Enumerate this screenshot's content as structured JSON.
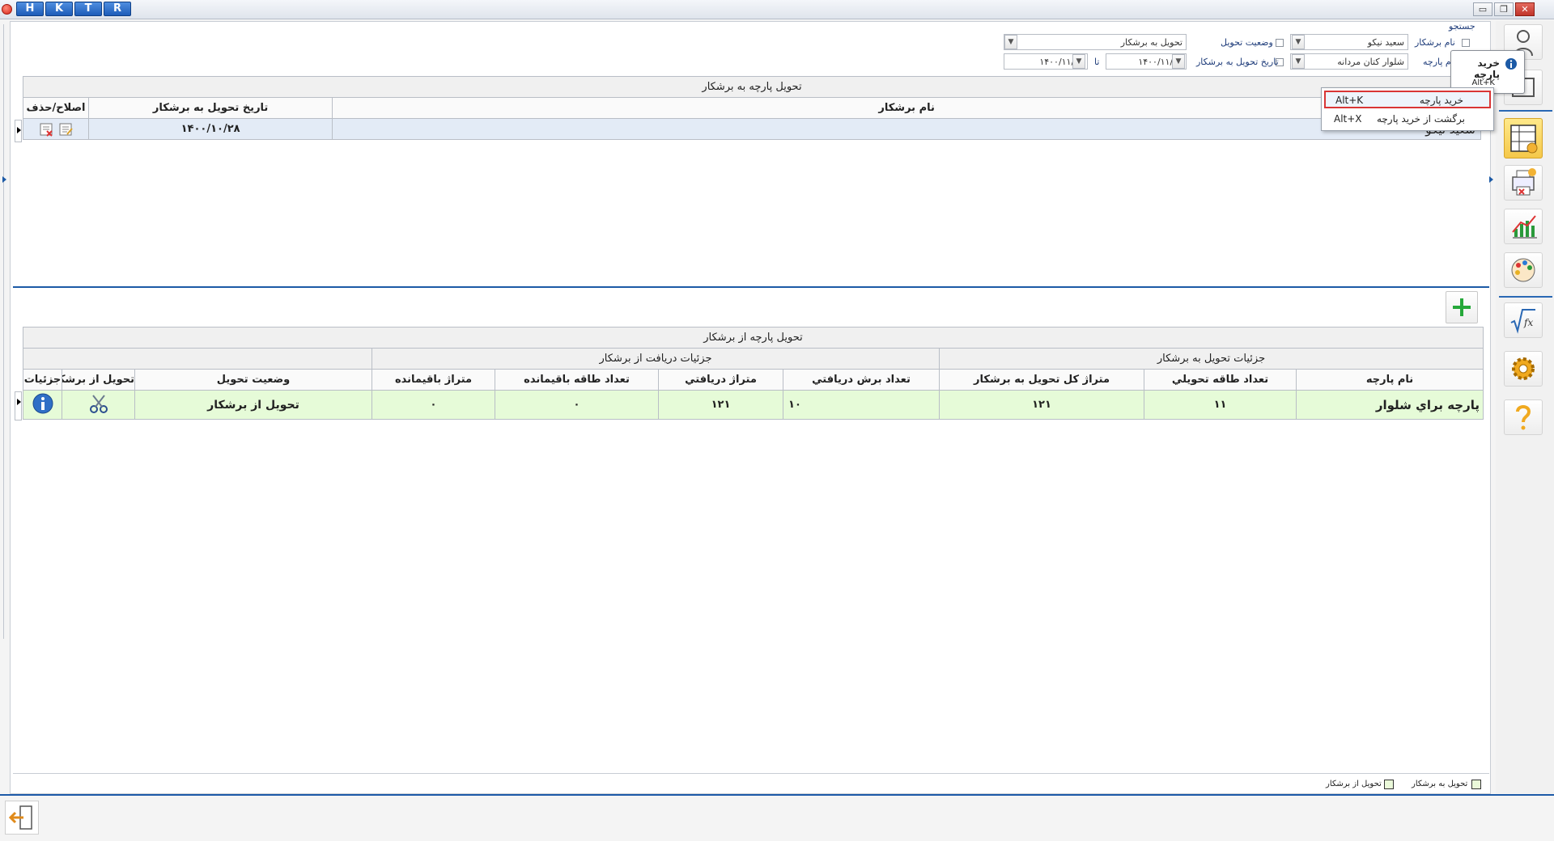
{
  "titlebar": {
    "letters": [
      "H",
      "K",
      "T",
      "R"
    ],
    "win_buttons": {
      "minimize": "▭",
      "restore": "❐",
      "close": "✕"
    }
  },
  "filters": {
    "search_label": "جستجو",
    "tailor_name_label": "نام برشکار",
    "tailor_name_value": "سعيد نيکو",
    "fabric_name_label": "نام پارچه",
    "fabric_name_value": "شلوار کتان مردانه",
    "delivery_status_label": "وضعيت تحويل",
    "delivery_status_value": "تحويل به برشکار",
    "delivery_date_label": "تاريخ تحويل به برشکار",
    "date_from": "۱۴۰۰/۱۱/۰۱",
    "to_label": "تا",
    "date_to": "۱۴۰۰/۱۱/۰۳"
  },
  "table1": {
    "caption": "تحويل پارچه به برشکار",
    "headers": [
      "نام برشکار",
      "تاريخ تحويل به برشکار",
      "اصلاح/حذف"
    ],
    "rows": [
      {
        "tailor": "سعيد نيکو",
        "date": "۱۴۰۰/۱۰/۲۸"
      }
    ]
  },
  "table2": {
    "caption": "تحويل پارچه از برشکار",
    "groups": [
      "جزئيات تحويل به برشکار",
      "جزئيات دريافت از برشکار"
    ],
    "headers": [
      "نام پارچه",
      "تعداد طاقه تحويلي",
      "متراژ کل تحويل به برشکار",
      "تعداد برش دريافتي",
      "متراژ دريافتي",
      "تعداد طاقه باقيمانده",
      "متراژ باقيمانده",
      "وضعيت تحويل",
      "تحويل از برشکار",
      "جزئيات"
    ],
    "rows": [
      {
        "fabric": "پارچه براي شلوار",
        "rolls": "۱۱",
        "total_meter": "۱۲۱",
        "cuts": "۱۰",
        "received_meter": "۱۲۱",
        "remaining_rolls": "۰",
        "remaining_meter": "۰",
        "status": "تحويل از برشکار"
      }
    ]
  },
  "menu": {
    "items": [
      {
        "label": "خريد پارچه",
        "shortcut": "Alt+K"
      },
      {
        "label": "برگشت از خريد پارچه",
        "shortcut": "Alt+X"
      }
    ]
  },
  "tooltip": {
    "title": "خريد پارچه",
    "shortcut_partial": "Alt+K"
  },
  "legend": {
    "items": [
      "تحويل به برشکار",
      "تحويل از برشکار"
    ]
  },
  "colors": {
    "accent": "#1c5aa6",
    "green_row": "#e6fbd8",
    "selected_row": "#e3ebf6",
    "active_tool": "#f5c84a"
  }
}
